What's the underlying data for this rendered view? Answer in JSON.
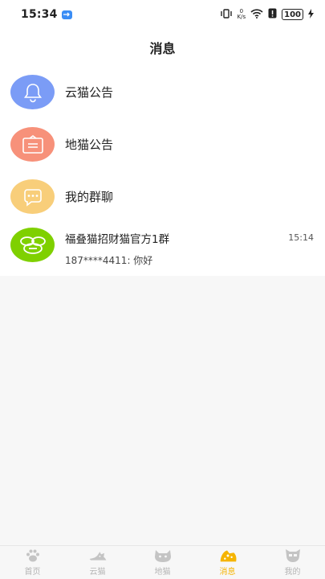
{
  "status": {
    "time": "15:34",
    "net_value": "0",
    "net_unit": "K/s",
    "battery": "100"
  },
  "header": {
    "title": "消息"
  },
  "list": {
    "items": [
      {
        "label": "云猫公告",
        "icon": "bell-icon",
        "color": "#7b9cf6"
      },
      {
        "label": "地猫公告",
        "icon": "notice-board-icon",
        "color": "#f7917a"
      },
      {
        "label": "我的群聊",
        "icon": "chat-bubble-icon",
        "color": "#f8ce7a"
      }
    ],
    "chat": {
      "title": "福叠猫招财猫官方1群",
      "message": "187****4411: 你好",
      "time": "15:14",
      "avatar_color": "#7fd000"
    }
  },
  "tabbar": {
    "tabs": [
      {
        "label": "首页",
        "icon": "paw-icon"
      },
      {
        "label": "云猫",
        "icon": "cloud-cat-icon"
      },
      {
        "label": "地猫",
        "icon": "cat-face-icon"
      },
      {
        "label": "消息",
        "icon": "message-cat-icon",
        "active": true
      },
      {
        "label": "我的",
        "icon": "profile-cat-icon"
      }
    ],
    "active_color": "#f5b400",
    "inactive_color": "#b5b5b5"
  }
}
